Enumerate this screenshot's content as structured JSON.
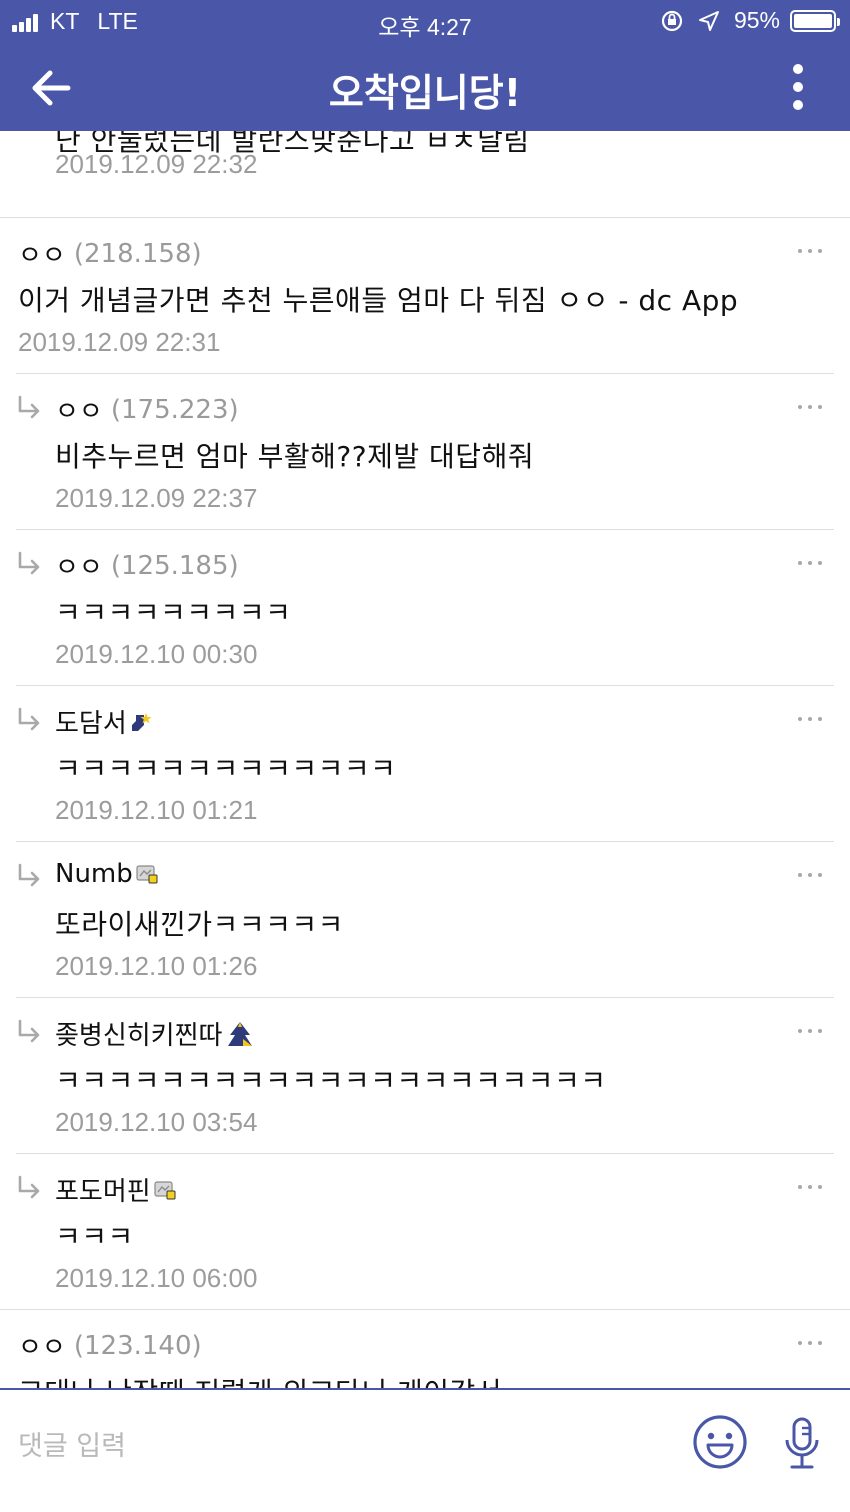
{
  "status_bar": {
    "carrier": "KT",
    "network": "LTE",
    "time": "오후 4:27",
    "battery_percent": "95%",
    "battery_level": 0.95,
    "icons": [
      "signal-icon",
      "orientation-lock-icon",
      "location-icon",
      "battery-icon"
    ]
  },
  "header": {
    "title": "오착입니당!",
    "back_icon": "arrow-left-icon",
    "menu_icon": "more-vertical-icon",
    "bg_color": "#4a57a8"
  },
  "comments": [
    {
      "text": "난 안눌렀는데 발란스맞춘다고 ㅂㅊ날림",
      "date": "2019.12.09 22:32"
    },
    {
      "name": "ㅇㅇ",
      "ip": "(218.158)",
      "text": "이거 개념글가면 추천 누른애들 엄마 다 뒤짐 ㅇㅇ - dc App",
      "date": "2019.12.09 22:31"
    },
    {
      "name": "ㅇㅇ",
      "ip": "(175.223)",
      "text": "비추누르면 엄마 부활해??제발 대답해줘",
      "date": "2019.12.09 22:37"
    },
    {
      "name": "ㅇㅇ",
      "ip": "(125.185)",
      "text": "ㅋㅋㅋㅋㅋㅋㅋㅋㅋ",
      "date": "2019.12.10 00:30"
    },
    {
      "name": "도담서",
      "badge": "fixed-nick-badge-icon",
      "text": "ㅋㅋㅋㅋㅋㅋㅋㅋㅋㅋㅋㅋㅋ",
      "date": "2019.12.10 01:21"
    },
    {
      "name": "Numb",
      "badge": "half-fixed-nick-badge-icon",
      "text": "또라이새낀가ㅋㅋㅋㅋㅋ",
      "date": "2019.12.10 01:26"
    },
    {
      "name": "좆병신히키찐따",
      "badge": "tree-badge-icon",
      "text": "ㅋㅋㅋㅋㅋㅋㅋㅋㅋㅋㅋㅋㅋㅋㅋㅋㅋㅋㅋㅋㅋ",
      "date": "2019.12.10 03:54"
    },
    {
      "name": "포도머핀",
      "badge": "half-fixed-nick-badge-icon",
      "text": "ㅋㅋㅋ",
      "date": "2019.12.10 06:00"
    },
    {
      "name": "ㅇㅇ",
      "ip": "(123.140)",
      "text": "그대나 난장때 저렇게 외고다니 게이같서"
    }
  ],
  "input_bar": {
    "placeholder": "댓글 입력",
    "emoji_icon": "emoji-icon",
    "mic_icon": "microphone-icon",
    "accent_color": "#4a57a8"
  }
}
